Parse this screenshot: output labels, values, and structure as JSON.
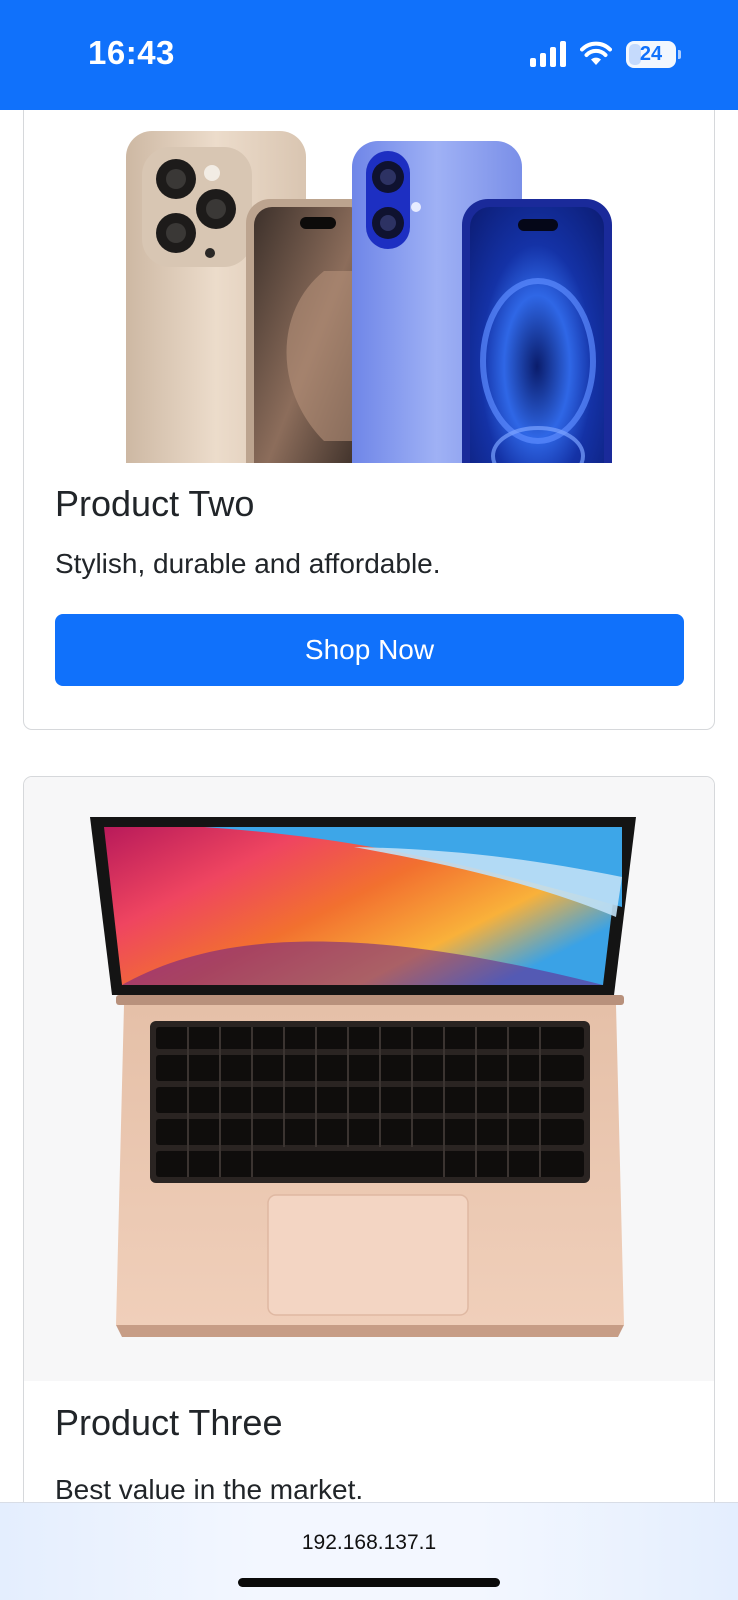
{
  "status_bar": {
    "time": "16:43",
    "battery": "24",
    "background_color": "#1071fb",
    "icons": [
      "cellular-signal-icon",
      "wifi-icon",
      "battery-icon"
    ]
  },
  "products": [
    {
      "title": "Product Two",
      "description": "Stylish, durable and affordable.",
      "button_label": "Shop Now",
      "image": "smartphones-product-image"
    },
    {
      "title": "Product Three",
      "description": "Best value in the market.",
      "image": "laptop-product-image"
    }
  ],
  "accent_color": "#1071fb",
  "browser": {
    "url": "192.168.137.1"
  }
}
